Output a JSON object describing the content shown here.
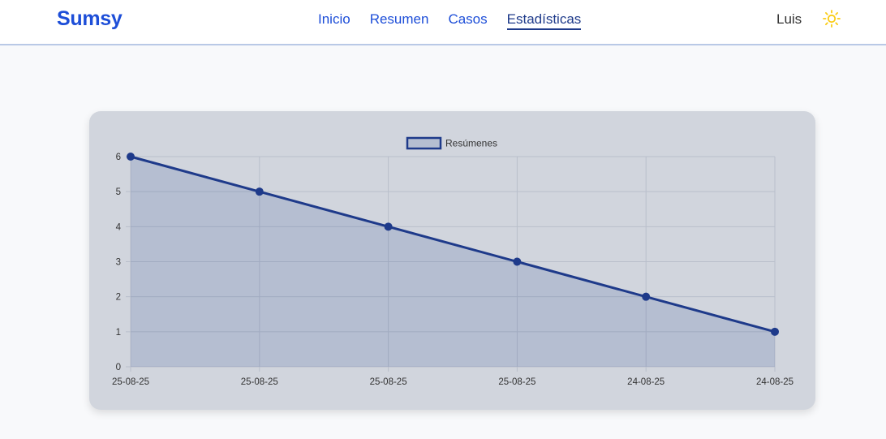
{
  "app": {
    "brand": "Sumsy",
    "user": "Luis",
    "theme_icon": "sun-icon"
  },
  "nav": {
    "items": [
      {
        "label": "Inicio",
        "active": false
      },
      {
        "label": "Resumen",
        "active": false
      },
      {
        "label": "Casos",
        "active": false
      },
      {
        "label": "Estadísticas",
        "active": true
      }
    ]
  },
  "colors": {
    "brand": "#1d4ed8",
    "active_nav": "#1e3a8a",
    "series_line": "#1e3a8a",
    "series_fill": "rgba(30,58,138,0.15)",
    "sun": "#facc15"
  },
  "chart_data": {
    "type": "line",
    "categories": [
      "25-08-25",
      "25-08-25",
      "25-08-25",
      "25-08-25",
      "24-08-25",
      "24-08-25"
    ],
    "series": [
      {
        "name": "Resúmenes",
        "values": [
          6,
          5,
          4,
          3,
          2,
          1
        ],
        "fill": true
      }
    ],
    "yticks": [
      "0",
      "1",
      "2",
      "3",
      "4",
      "5",
      "6"
    ],
    "ylim": [
      0,
      6
    ],
    "grid": true,
    "legend_position": "top-center"
  }
}
